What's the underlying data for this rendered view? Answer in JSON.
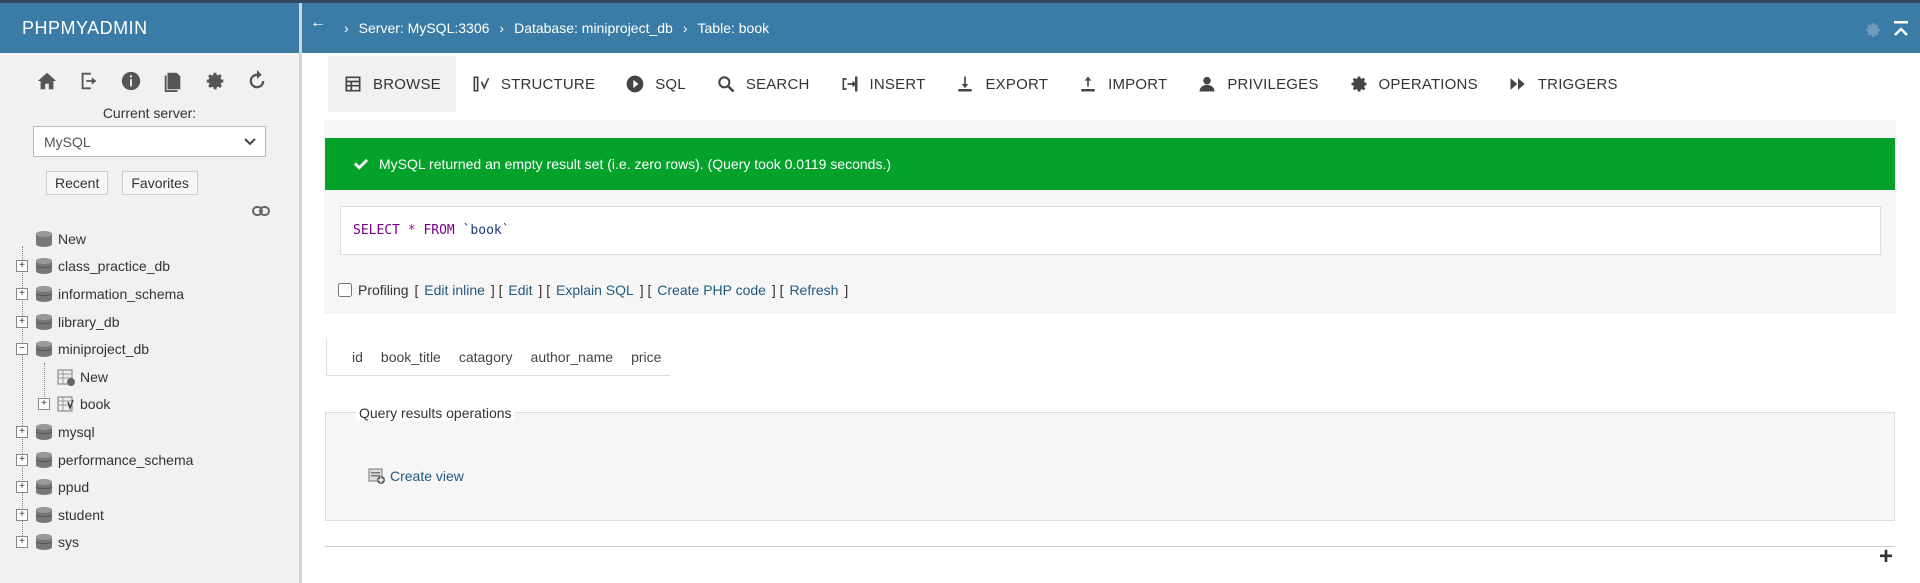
{
  "sidebar": {
    "logo": "PHPMYADMIN",
    "nav_icons": [
      "home-icon",
      "logout-icon",
      "info-icon",
      "docs-icon",
      "settings-icon",
      "reload-icon"
    ],
    "current_server_label": "Current server:",
    "server_select": "MySQL",
    "recent_label": "Recent",
    "favorites_label": "Favorites",
    "tree": [
      {
        "label": "New",
        "type": "new",
        "level": 0
      },
      {
        "label": "class_practice_db",
        "type": "db",
        "level": 0
      },
      {
        "label": "information_schema",
        "type": "db",
        "level": 0
      },
      {
        "label": "library_db",
        "type": "db",
        "level": 0
      },
      {
        "label": "miniproject_db",
        "type": "db",
        "level": 0,
        "expanded": true
      },
      {
        "label": "New",
        "type": "new-table",
        "level": 1
      },
      {
        "label": "book",
        "type": "table",
        "level": 1
      },
      {
        "label": "mysql",
        "type": "db",
        "level": 0
      },
      {
        "label": "performance_schema",
        "type": "db",
        "level": 0
      },
      {
        "label": "ppud",
        "type": "db",
        "level": 0
      },
      {
        "label": "student",
        "type": "db",
        "level": 0
      },
      {
        "label": "sys",
        "type": "db",
        "level": 0
      }
    ]
  },
  "header": {
    "back": "←",
    "breadcrumb": {
      "server": "Server: MySQL:3306",
      "database": "Database: miniproject_db",
      "table": "Table: book"
    },
    "sep": "›"
  },
  "tabs": [
    {
      "label": "BROWSE",
      "icon": "browse-icon",
      "active": true
    },
    {
      "label": "STRUCTURE",
      "icon": "structure-icon"
    },
    {
      "label": "SQL",
      "icon": "sql-icon"
    },
    {
      "label": "SEARCH",
      "icon": "search-icon"
    },
    {
      "label": "INSERT",
      "icon": "insert-icon"
    },
    {
      "label": "EXPORT",
      "icon": "export-icon"
    },
    {
      "label": "IMPORT",
      "icon": "import-icon"
    },
    {
      "label": "PRIVILEGES",
      "icon": "privileges-icon"
    },
    {
      "label": "OPERATIONS",
      "icon": "operations-icon"
    },
    {
      "label": "TRIGGERS",
      "icon": "triggers-icon"
    }
  ],
  "message": "MySQL returned an empty result set (i.e. zero rows). (Query took 0.0119 seconds.)",
  "query": {
    "select": "SELECT",
    "star": "*",
    "from": "FROM",
    "table": "`book`"
  },
  "profiling": {
    "label": "Profiling",
    "links": [
      "Edit inline",
      "Edit",
      "Explain SQL",
      "Create PHP code",
      "Refresh"
    ]
  },
  "columns": [
    "id",
    "book_title",
    "catagory",
    "author_name",
    "price"
  ],
  "qro": {
    "title": "Query results operations",
    "create_view": "Create view"
  },
  "footer": {
    "plus": "+"
  },
  "colors": {
    "header": "#3a7ca5",
    "success": "#04a12b",
    "link": "#235a81"
  }
}
